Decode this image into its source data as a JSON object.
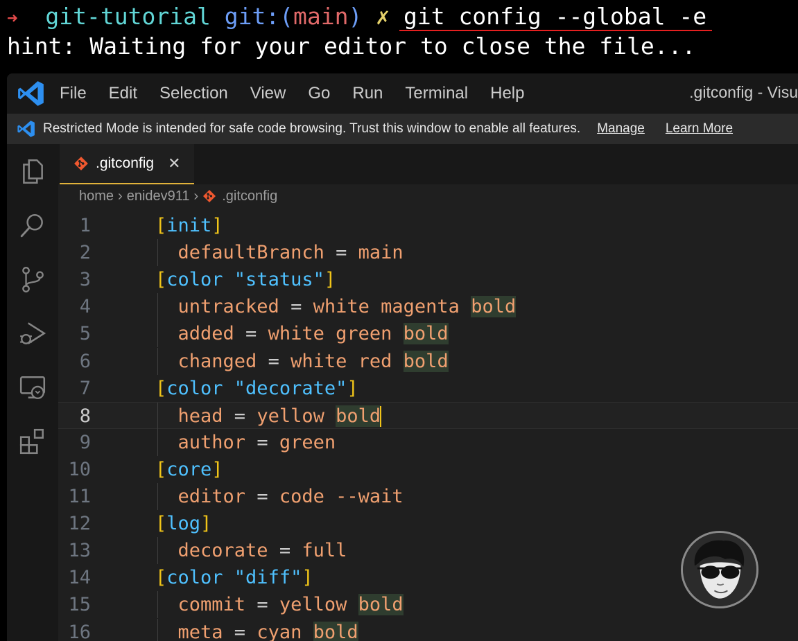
{
  "terminal": {
    "arrow": "➜",
    "dir": "git-tutorial",
    "git_prefix": "git:(",
    "branch": "main",
    "git_suffix": ")",
    "dirty": "✗",
    "command": "git config --global -e",
    "hint": "hint: Waiting for your editor to close the file..."
  },
  "menu": [
    "File",
    "Edit",
    "Selection",
    "View",
    "Go",
    "Run",
    "Terminal",
    "Help"
  ],
  "window_title": ".gitconfig - Visu",
  "banner": {
    "text": "Restricted Mode is intended for safe code browsing. Trust this window to enable all features.",
    "manage": "Manage",
    "learn_more": "Learn More"
  },
  "tab": {
    "label": ".gitconfig",
    "close": "✕"
  },
  "breadcrumb": [
    "home",
    "enidev911",
    ".gitconfig"
  ],
  "breadcrumb_sep": "›",
  "lines": [
    {
      "n": "1",
      "t": "section",
      "name": "init"
    },
    {
      "n": "2",
      "t": "kv",
      "key": "defaultBranch",
      "val": "main"
    },
    {
      "n": "3",
      "t": "section",
      "name": "color \"status\""
    },
    {
      "n": "4",
      "t": "kv",
      "key": "untracked",
      "val": "white magenta",
      "bold": true
    },
    {
      "n": "5",
      "t": "kv",
      "key": "added",
      "val": "white green",
      "bold": true
    },
    {
      "n": "6",
      "t": "kv",
      "key": "changed",
      "val": "white red",
      "bold": true
    },
    {
      "n": "7",
      "t": "section",
      "name": "color \"decorate\""
    },
    {
      "n": "8",
      "t": "kv",
      "key": "head",
      "val": "yellow",
      "bold": true,
      "current": true
    },
    {
      "n": "9",
      "t": "kv",
      "key": "author",
      "val": "green"
    },
    {
      "n": "10",
      "t": "section",
      "name": "core"
    },
    {
      "n": "11",
      "t": "kv",
      "key": "editor",
      "val": "code --wait"
    },
    {
      "n": "12",
      "t": "section",
      "name": "log"
    },
    {
      "n": "13",
      "t": "kv",
      "key": "decorate",
      "val": "full"
    },
    {
      "n": "14",
      "t": "section",
      "name": "color \"diff\""
    },
    {
      "n": "15",
      "t": "kv",
      "key": "commit",
      "val": "yellow",
      "bold": true
    },
    {
      "n": "16",
      "t": "kv",
      "key": "meta",
      "val": "cyan",
      "bold": true
    }
  ],
  "bold_word": "bold",
  "icons": {
    "vscode": "vscode-logo-icon",
    "explorer": "files-icon",
    "search": "search-icon",
    "scm": "source-control-icon",
    "debug": "run-debug-icon",
    "remote": "remote-explorer-icon",
    "extensions": "extensions-icon",
    "file": "git-file-icon"
  },
  "colors": {
    "accent": "#e1b23a",
    "vscode_blue": "#2d8ff0",
    "git_orange": "#f0582f"
  }
}
